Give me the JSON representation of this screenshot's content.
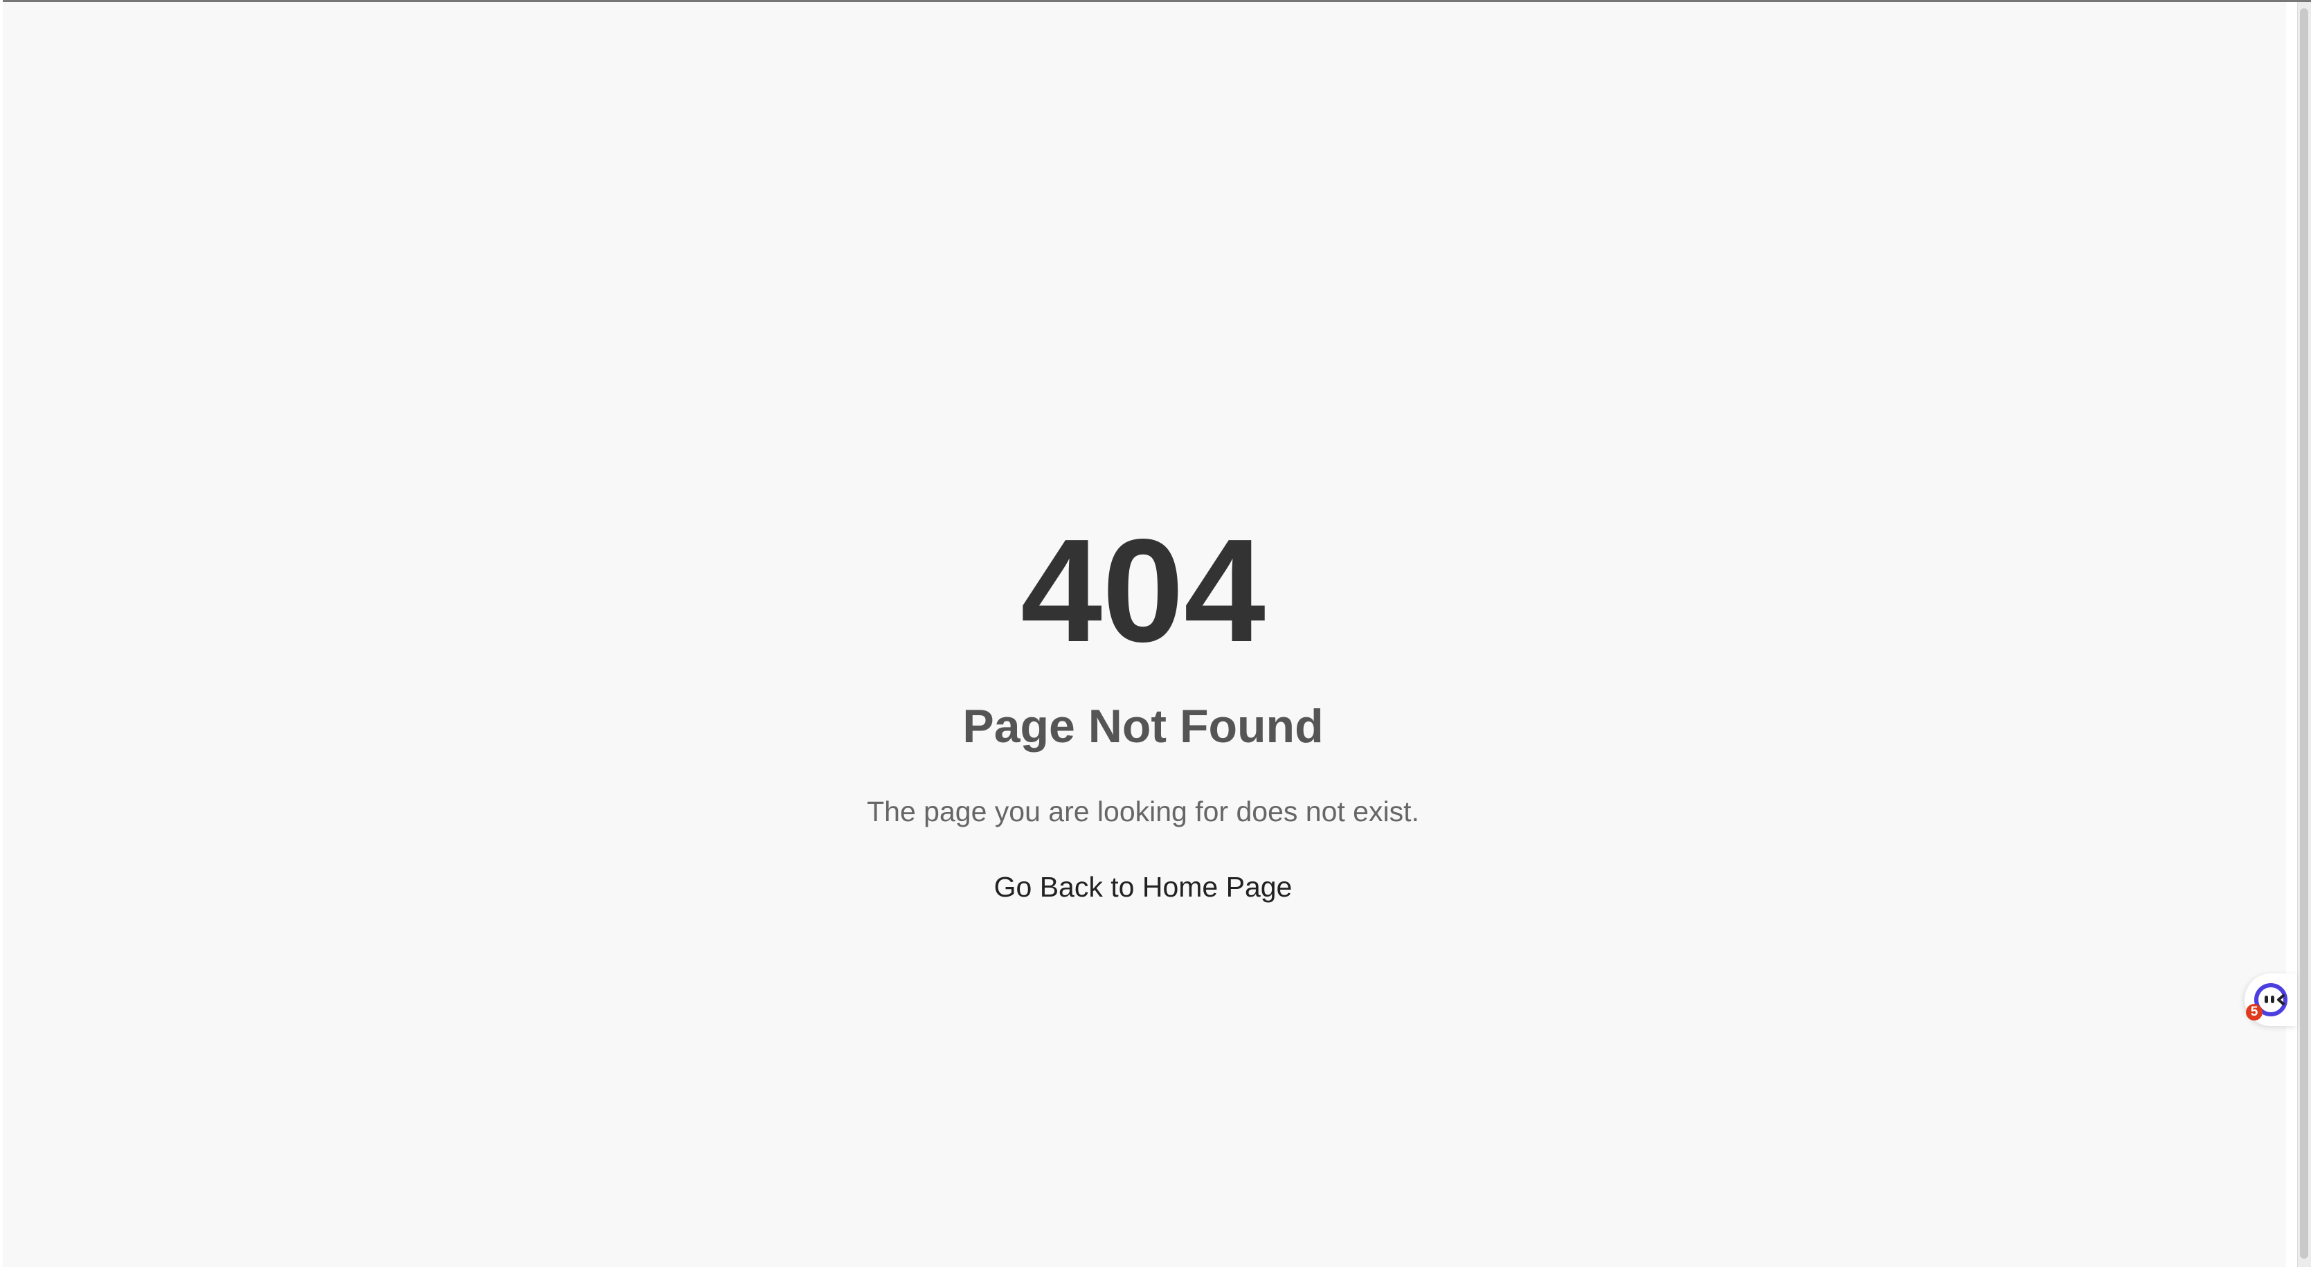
{
  "page": {
    "error_code": "404",
    "title": "Page Not Found",
    "message": "The page you are looking for does not exist.",
    "home_link_label": "Go Back to Home Page"
  },
  "widget": {
    "icon": "assistant-face-icon",
    "badge_count": "5",
    "accent_color": "#4b3fe0",
    "badge_color": "#e03a1e"
  },
  "colors": {
    "background": "#f8f8f8",
    "code_text": "#333333",
    "title_text": "#555555",
    "message_text": "#666666",
    "link_text": "#222222"
  }
}
